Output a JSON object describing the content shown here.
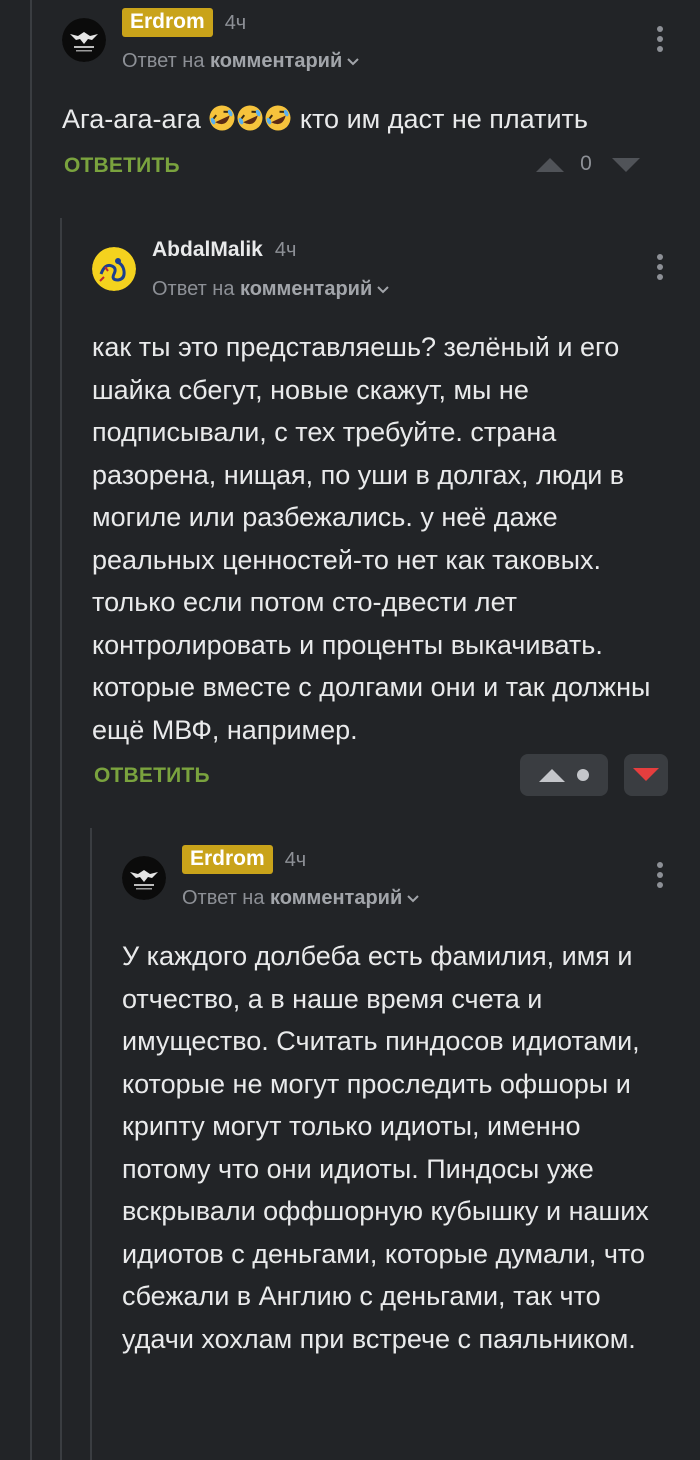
{
  "comments": [
    {
      "author": "Erdrom",
      "time": "4ч",
      "reply_prefix": "Ответ на",
      "reply_target": "комментарий",
      "text_before_emoji": "Ага-ага-ага",
      "emoji": [
        "rolling-on-floor-laughing",
        "rolling-on-floor-laughing",
        "rolling-on-floor-laughing"
      ],
      "text_after_emoji": "кто им даст не платить",
      "reply_label": "ОТВЕТИТЬ",
      "score": "0"
    },
    {
      "author": "AbdalMalik",
      "time": "4ч",
      "reply_prefix": "Ответ на",
      "reply_target": "комментарий",
      "text": "как ты это представляешь? зелёный и его шайка сбегут, новые скажут, мы не подписывали, с тех требуйте. страна разорена, нищая, по уши в долгах, люди в могиле или разбежались. у неё даже реальных ценностей-то нет как таковых. только если потом сто-двести лет контролировать и проценты выкачивать. которые вместе с долгами они и так должны ещё МВФ, например.",
      "reply_label": "ОТВЕТИТЬ"
    },
    {
      "author": "Erdrom",
      "time": "4ч",
      "reply_prefix": "Ответ на",
      "reply_target": "комментарий",
      "text": "У каждого долбеба есть фамилия, имя и отчество, а в наше время счета и имущество. Считать пиндосов идиотами, которые не могут проследить офшоры и крипту могут только идиоты, именно потому что они идиоты. Пиндосы уже вскрывали оффшорную кубышку и наших идиотов с деньгами, которые думали, что сбежали в Англию с деньгами, так что удачи хохлам при встрече с паяльником."
    }
  ],
  "colors": {
    "background": "#222427",
    "author_badge": "#c9a31a",
    "reply_action": "#7aa33e",
    "downvote_active": "#e53e3e",
    "thread_line": "#3a3d41"
  }
}
